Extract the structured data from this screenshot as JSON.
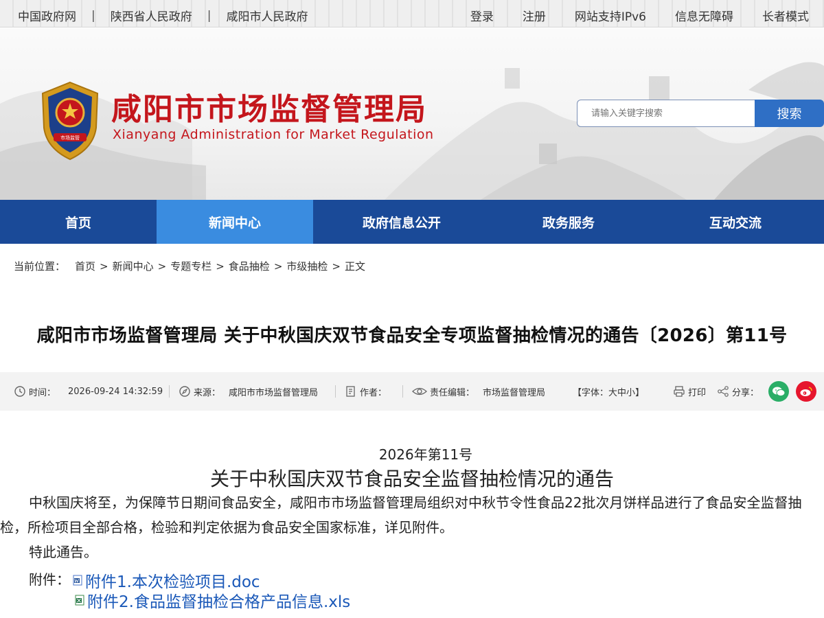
{
  "topbar": {
    "links_left": [
      "中国政府网",
      "陕西省人民政府",
      "咸阳市人民政府"
    ],
    "separator": "|",
    "links_right": [
      "登录",
      "注册",
      "网站支持IPv6",
      "信息无障碍",
      "长者模式"
    ]
  },
  "header": {
    "title": "咸阳市市场监督管理局",
    "subtitle": "Xianyang Administration for Market Regulation",
    "emblem_text": "市场监管",
    "search_placeholder": "请输入关键字搜索",
    "search_button": "搜索"
  },
  "nav": {
    "items": [
      "首页",
      "新闻中心",
      "政府信息公开",
      "政务服务",
      "互动交流"
    ],
    "active": "新闻中心"
  },
  "breadcrumb": {
    "label": "当前位置：",
    "items": [
      "首页",
      "新闻中心",
      "专题专栏",
      "食品抽检",
      "市级抽检",
      "正文"
    ],
    "sep": ">"
  },
  "article": {
    "headline": "咸阳市市场监督管理局 关于中秋国庆双节食品安全专项监督抽检情况的通告〔2026〕第11号",
    "info": {
      "time_label": "时间：",
      "time_value": "2026-09-24 14:32:59",
      "source_label": "来源：",
      "source_value": "咸阳市市场监督管理局",
      "author_label": "作者：",
      "editor_label": "责任编辑：",
      "editor_value": "市场监督管理局",
      "font_label_open": "【字体：",
      "font_sizes": [
        "大",
        "中",
        "小"
      ],
      "font_label_close": "】",
      "print_label": "打印",
      "share_label": "分享："
    },
    "doc_number": "2026年第11号",
    "doc_title": "关于中秋国庆双节食品安全监督抽检情况的通告",
    "paragraph": "中秋国庆将至，为保障节日期间食品安全，咸阳市市场监督管理局组织对中秋节令性食品22批次月饼样品进行了食品安全监督抽检，所检项目全部合格，检验和判定依据为食品安全国家标准，详见附件。",
    "closing": "特此通告。",
    "attachments_label": "附件：",
    "attachments": [
      "附件1.本次检验项目.doc",
      "附件2.食品监督抽检合格产品信息.xls"
    ]
  },
  "colors": {
    "brand_red": "#c4161c",
    "nav_blue": "#1a4a98",
    "nav_active": "#3a8ce0",
    "link_blue": "#1a58b8",
    "wechat_green": "#2aae67",
    "weibo_red": "#e6162d"
  }
}
